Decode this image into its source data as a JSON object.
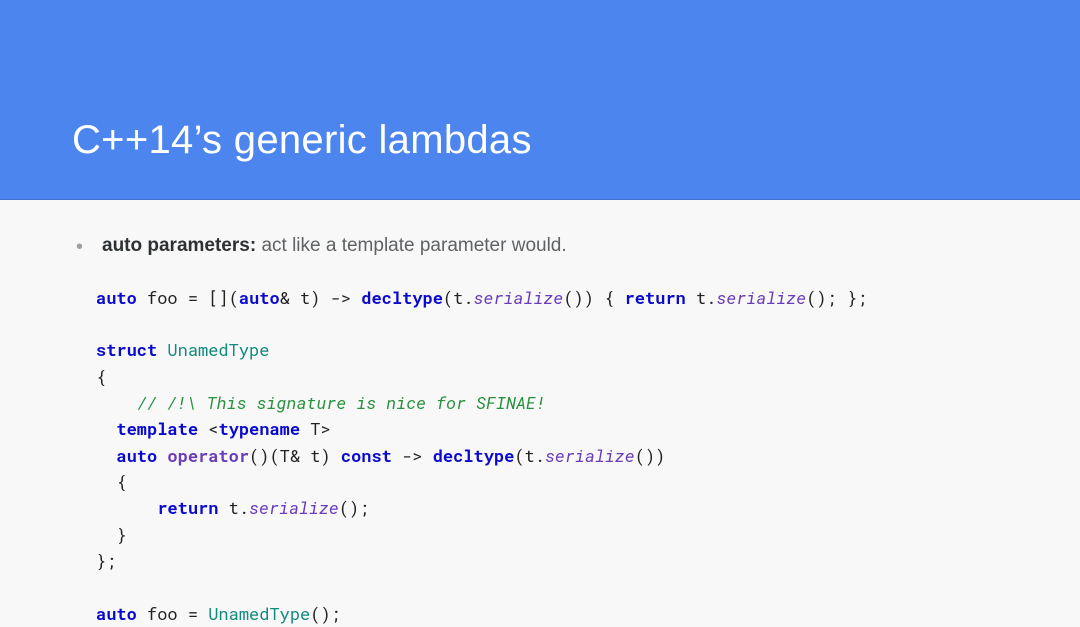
{
  "header": {
    "title": "C++14’s generic lambdas"
  },
  "bullets": [
    {
      "strong": "auto parameters:",
      "rest": " act like a template parameter would."
    }
  ],
  "code": {
    "l1": {
      "a": "auto",
      "b": " foo = [](",
      "c": "auto",
      "d": "& t) -> ",
      "e": "decltype",
      "f": "(t.",
      "g": "serialize",
      "h": "()) { ",
      "i": "return",
      "j": " t.",
      "k": "serialize",
      "l": "(); };"
    },
    "l3": {
      "a": "struct",
      "b": " ",
      "c": "UnamedType"
    },
    "l4": "{",
    "l5": {
      "a": "    ",
      "b": "// /!\\ This signature is nice for SFINAE!"
    },
    "l6": {
      "a": "  ",
      "b": "template",
      "c": " <",
      "d": "typename",
      "e": " T>"
    },
    "l7": {
      "a": "  ",
      "b": "auto",
      "c": " ",
      "d": "operator",
      "e": "()(T& t) ",
      "f": "const",
      "g": " -> ",
      "h": "decltype",
      "i": "(t.",
      "j": "serialize",
      "k": "())"
    },
    "l8": "  {",
    "l9": {
      "a": "      ",
      "b": "return",
      "c": " t.",
      "d": "serialize",
      "e": "();"
    },
    "l10": "  }",
    "l11": "};",
    "l13": {
      "a": "auto",
      "b": " foo = ",
      "c": "UnamedType",
      "d": "();"
    }
  }
}
